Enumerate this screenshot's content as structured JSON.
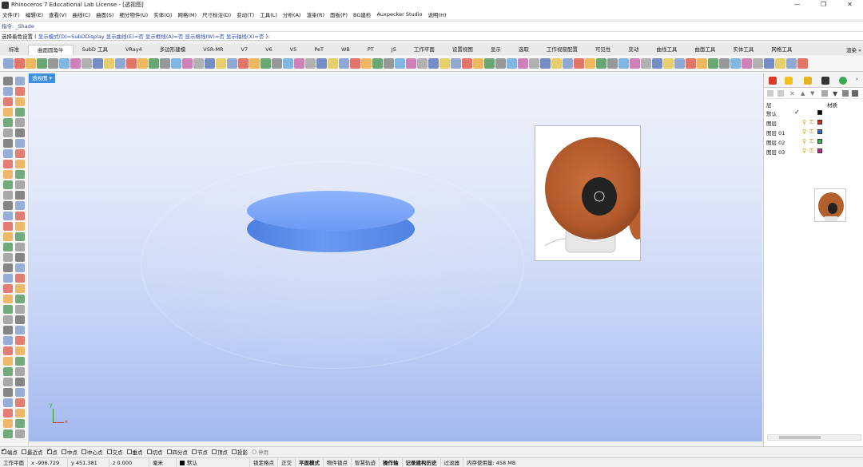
{
  "window": {
    "title": "Rhinoceros 7 Educational Lab License - [透视图]",
    "controls": [
      "—",
      "❐",
      "✕"
    ]
  },
  "menu": [
    "文件(F)",
    "编辑(E)",
    "查看(V)",
    "曲线(C)",
    "曲面(S)",
    "细分物件(U)",
    "实体(O)",
    "网格(M)",
    "尺寸标注(D)",
    "变动(T)",
    "工具(L)",
    "分析(A)",
    "渲染(R)",
    "面板(P)",
    "BG建检",
    "Auxpecker Studio",
    "说明(H)"
  ],
  "command": {
    "history": "指令: _Shade",
    "prompt_label": "选择着色设置 (",
    "options": [
      "显示模式(D)=SubDDisplay",
      "显示曲线(E)=否",
      "显示框线(A)=否",
      "显示格线(W)=否",
      "显示轴线(X)=否"
    ],
    "prompt_end": "):"
  },
  "tabs": {
    "items": [
      "标准",
      "曲面圆角牛",
      "SubD 工具",
      "VRay4",
      "多边形建模",
      "VSR-MR",
      "V7",
      "V6",
      "V5",
      "PeT",
      "WB",
      "PT",
      "JS",
      "工作平面",
      "设置视图",
      "显示",
      "选取",
      "工作视窗配置",
      "可见性",
      "变动",
      "曲线工具",
      "曲面工具",
      "实体工具",
      "网格工具"
    ],
    "active_index": 1,
    "more": "渲染 »"
  },
  "viewport": {
    "label": "透视图 ▾",
    "axis_x": "x",
    "axis_y": "y",
    "disc_color": "#5d8ff0"
  },
  "panel": {
    "header_name": "层",
    "header_material": "材质",
    "layers": [
      {
        "name": "默认",
        "current": true,
        "color": "#000000"
      },
      {
        "name": "图层",
        "current": false,
        "color": "#dd2222"
      },
      {
        "name": "图层 01",
        "current": false,
        "color": "#2a6ed8"
      },
      {
        "name": "图层 02",
        "current": false,
        "color": "#2fb34a"
      },
      {
        "name": "图层 03",
        "current": false,
        "color": "#c02a8a"
      }
    ]
  },
  "osnap": {
    "items": [
      {
        "label": "端点",
        "checked": true
      },
      {
        "label": "最近点",
        "checked": false
      },
      {
        "label": "点",
        "checked": true
      },
      {
        "label": "中点",
        "checked": false
      },
      {
        "label": "中心点",
        "checked": false
      },
      {
        "label": "交点",
        "checked": false
      },
      {
        "label": "垂点",
        "checked": false
      },
      {
        "label": "切点",
        "checked": false
      },
      {
        "label": "四分点",
        "checked": false
      },
      {
        "label": "节点",
        "checked": false
      },
      {
        "label": "顶点",
        "checked": false
      },
      {
        "label": "投影",
        "checked": false
      }
    ],
    "disable_label": "停用"
  },
  "status": {
    "plane": "工作平面",
    "x": "x -906.729",
    "y": "y 451.381",
    "z": "z 0.000",
    "unit": "毫米",
    "layer": "默认",
    "grid_snap": "锁定格点",
    "ortho": "正交",
    "planar": "平面模式",
    "osnap": "物件锁点",
    "smarttrack": "智慧轨迹",
    "gumball": "操作轴",
    "history": "记录建构历史",
    "filter": "过滤器",
    "memory": "内存使用量: 458 MB"
  }
}
